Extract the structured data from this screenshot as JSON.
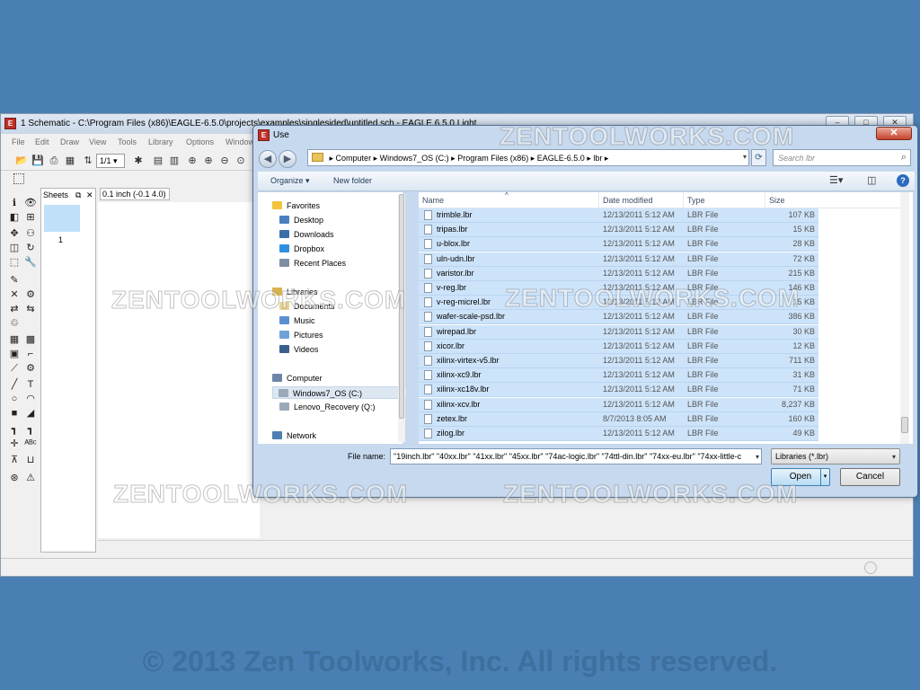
{
  "eagle": {
    "title": "1 Schematic - C:\\Program Files (x86)\\EAGLE-6.5.0\\projects\\examples\\singlesided\\untitled.sch - EAGLE 6.5.0 Light",
    "menu": [
      "File",
      "Edit",
      "Draw",
      "View",
      "Tools",
      "Library",
      "Options",
      "Window"
    ],
    "zoom": "1/1",
    "sheets_label": "Sheets",
    "sheet_number": "1",
    "coordinate": "0.1 inch (-0.1 4.0)"
  },
  "dialog": {
    "title": "Use",
    "breadcrumbs": [
      "Computer",
      "Windows7_OS (C:)",
      "Program Files (x86)",
      "EAGLE-6.5.0",
      "lbr"
    ],
    "search_placeholder": "Search lbr",
    "organize": "Organize ▾",
    "new_folder": "New folder",
    "nav": {
      "favorites": "Favorites",
      "desktop": "Desktop",
      "downloads": "Downloads",
      "dropbox": "Dropbox",
      "recent": "Recent Places",
      "libraries": "Libraries",
      "documents": "Documents",
      "music": "Music",
      "pictures": "Pictures",
      "videos": "Videos",
      "computer": "Computer",
      "drive_c": "Windows7_OS (C:)",
      "drive_q": "Lenovo_Recovery (Q:)",
      "network": "Network"
    },
    "columns": {
      "name": "Name",
      "date": "Date modified",
      "type": "Type",
      "size": "Size"
    },
    "files": [
      {
        "name": "trimble.lbr",
        "date": "12/13/2011 5:12 AM",
        "type": "LBR File",
        "size": "107 KB"
      },
      {
        "name": "tripas.lbr",
        "date": "12/13/2011 5:12 AM",
        "type": "LBR File",
        "size": "15 KB"
      },
      {
        "name": "u-blox.lbr",
        "date": "12/13/2011 5:12 AM",
        "type": "LBR File",
        "size": "28 KB"
      },
      {
        "name": "uln-udn.lbr",
        "date": "12/13/2011 5:12 AM",
        "type": "LBR File",
        "size": "72 KB"
      },
      {
        "name": "varistor.lbr",
        "date": "12/13/2011 5:12 AM",
        "type": "LBR File",
        "size": "215 KB"
      },
      {
        "name": "v-reg.lbr",
        "date": "12/13/2011 5:12 AM",
        "type": "LBR File",
        "size": "146 KB"
      },
      {
        "name": "v-reg-micrel.lbr",
        "date": "12/13/2011 5:12 AM",
        "type": "LBR File",
        "size": "15 KB"
      },
      {
        "name": "wafer-scale-psd.lbr",
        "date": "12/13/2011 5:12 AM",
        "type": "LBR File",
        "size": "386 KB"
      },
      {
        "name": "wirepad.lbr",
        "date": "12/13/2011 5:12 AM",
        "type": "LBR File",
        "size": "30 KB"
      },
      {
        "name": "xicor.lbr",
        "date": "12/13/2011 5:12 AM",
        "type": "LBR File",
        "size": "12 KB"
      },
      {
        "name": "xilinx-virtex-v5.lbr",
        "date": "12/13/2011 5:12 AM",
        "type": "LBR File",
        "size": "711 KB"
      },
      {
        "name": "xilinx-xc9.lbr",
        "date": "12/13/2011 5:12 AM",
        "type": "LBR File",
        "size": "31 KB"
      },
      {
        "name": "xilinx-xc18v.lbr",
        "date": "12/13/2011 5:12 AM",
        "type": "LBR File",
        "size": "71 KB"
      },
      {
        "name": "xilinx-xcv.lbr",
        "date": "12/13/2011 5:12 AM",
        "type": "LBR File",
        "size": "8,237 KB"
      },
      {
        "name": "zetex.lbr",
        "date": "8/7/2013 8:05 AM",
        "type": "LBR File",
        "size": "160 KB"
      },
      {
        "name": "zilog.lbr",
        "date": "12/13/2011 5:12 AM",
        "type": "LBR File",
        "size": "49 KB"
      }
    ],
    "file_name_label": "File name:",
    "file_name_value": "\"19inch.lbr\" \"40xx.lbr\" \"41xx.lbr\" \"45xx.lbr\" \"74ac-logic.lbr\" \"74ttl-din.lbr\" \"74xx-eu.lbr\" \"74xx-little-c",
    "file_type": "Libraries (*.lbr)",
    "open": "Open",
    "cancel": "Cancel"
  },
  "watermark": "ZENTOOLWORKS.COM",
  "copyright": "© 2013 Zen Toolworks, Inc. All rights reserved."
}
